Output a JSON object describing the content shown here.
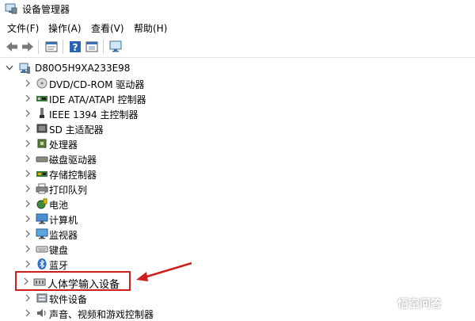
{
  "window": {
    "title": "设备管理器"
  },
  "menus": [
    "文件(F)",
    "操作(A)",
    "查看(V)",
    "帮助(H)"
  ],
  "toolbar": {
    "buttons": [
      "back-arrow-icon",
      "forward-arrow-icon",
      "properties-icon",
      "help-icon",
      "show-hidden-icon",
      "monitor-scan-icon"
    ]
  },
  "tree": {
    "root": {
      "label": "D80O5H9XA233E98",
      "icon": "computer-icon",
      "expanded": true
    },
    "items": [
      {
        "label": "DVD/CD-ROM 驱动器",
        "icon": "dvd-drive-icon"
      },
      {
        "label": "IDE ATA/ATAPI 控制器",
        "icon": "ide-controller-icon"
      },
      {
        "label": "IEEE 1394 主控制器",
        "icon": "ieee1394-icon"
      },
      {
        "label": "SD 主适配器",
        "icon": "sd-adapter-icon"
      },
      {
        "label": "处理器",
        "icon": "processor-icon"
      },
      {
        "label": "磁盘驱动器",
        "icon": "disk-drive-icon"
      },
      {
        "label": "存储控制器",
        "icon": "storage-controller-icon"
      },
      {
        "label": "打印队列",
        "icon": "printer-icon"
      },
      {
        "label": "电池",
        "icon": "battery-icon"
      },
      {
        "label": "计算机",
        "icon": "computer-monitor-icon"
      },
      {
        "label": "监视器",
        "icon": "monitor-icon"
      },
      {
        "label": "键盘",
        "icon": "keyboard-icon"
      },
      {
        "label": "蓝牙",
        "icon": "bluetooth-icon"
      },
      {
        "label": "人体学输入设备",
        "icon": "hid-icon",
        "highlighted": true
      },
      {
        "label": "软件设备",
        "icon": "software-device-icon"
      },
      {
        "label": "声音、视频和游戏控制器",
        "icon": "sound-icon"
      }
    ]
  },
  "annotation": {
    "color": "#cc2020"
  },
  "watermark": {
    "text": "悟空问答"
  }
}
